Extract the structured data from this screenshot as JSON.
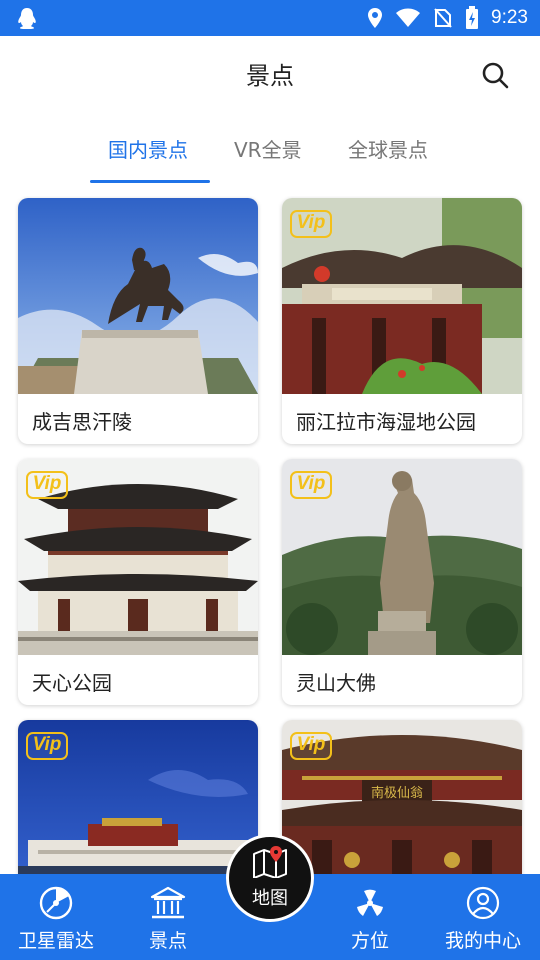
{
  "status_bar": {
    "time": "9:23",
    "icons": [
      "qq-icon",
      "location-icon",
      "wifi-icon",
      "no-sim-icon",
      "battery-charging-icon"
    ]
  },
  "header": {
    "title": "景点",
    "search_icon": "search-icon"
  },
  "tabs": [
    {
      "label": "国内景点",
      "active": true
    },
    {
      "label": "VR全景",
      "active": false
    },
    {
      "label": "全球景点",
      "active": false
    }
  ],
  "cards": [
    {
      "name": "成吉思汗陵",
      "vip": false
    },
    {
      "name": "丽江拉市海湿地公园",
      "vip": true,
      "vip_label": "Vip"
    },
    {
      "name": "天心公园",
      "vip": true,
      "vip_label": "Vip"
    },
    {
      "name": "灵山大佛",
      "vip": true,
      "vip_label": "Vip"
    },
    {
      "name": "",
      "vip": true,
      "vip_label": "Vip"
    },
    {
      "name": "",
      "vip": true,
      "vip_label": "Vip",
      "sign_text": "南极仙翁"
    }
  ],
  "bottom_nav": {
    "items": [
      {
        "label": "卫星雷达",
        "icon": "radar-icon"
      },
      {
        "label": "景点",
        "icon": "temple-icon"
      },
      {
        "label": "地图",
        "icon": "map-pin-icon"
      },
      {
        "label": "方位",
        "icon": "compass-icon"
      },
      {
        "label": "我的中心",
        "icon": "user-icon"
      }
    ]
  },
  "colors": {
    "primary": "#1f73e8",
    "vip": "#f3c01a",
    "fab": "#111111"
  }
}
